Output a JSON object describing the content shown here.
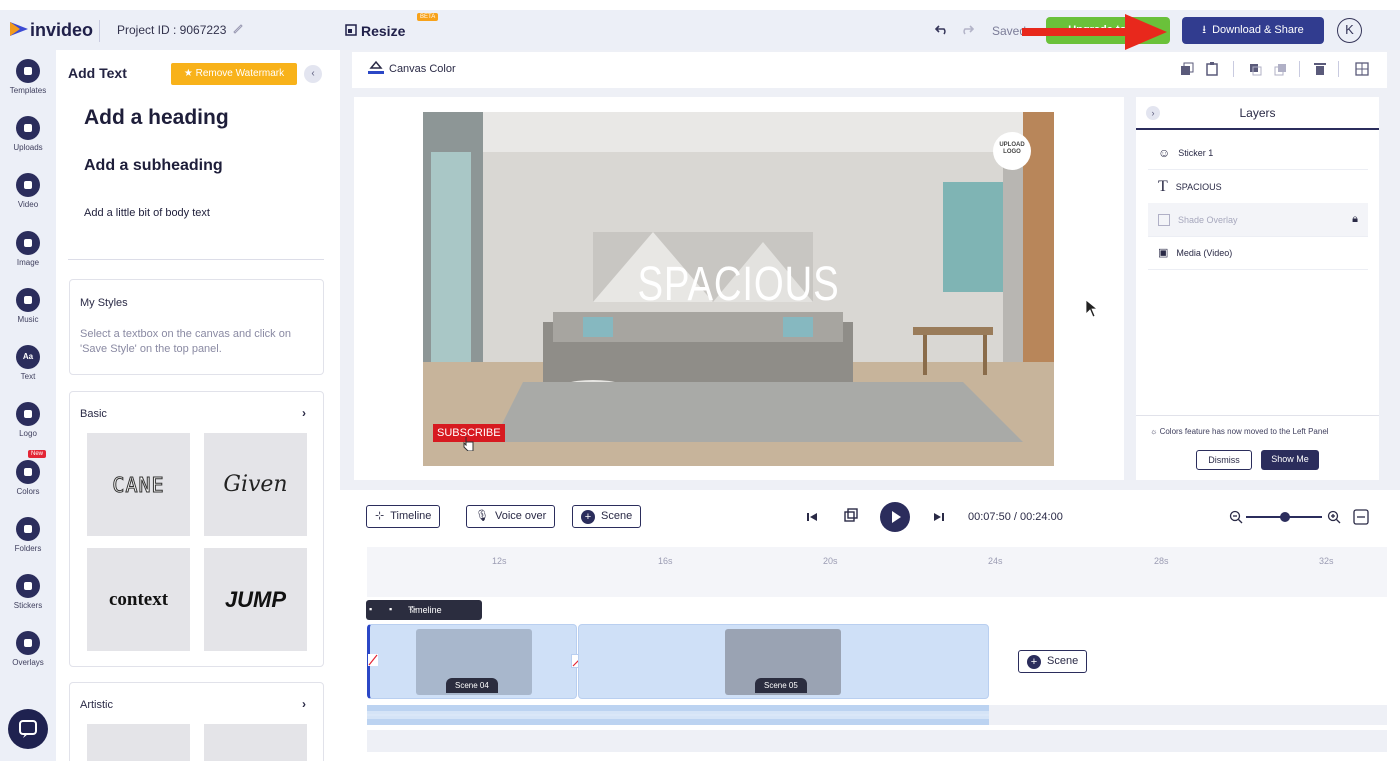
{
  "topbar": {
    "logo_text": "invideo",
    "project_id": "Project ID : 9067223",
    "resize_label": "Resize",
    "beta_badge": "BETA",
    "saved_text": "Saved",
    "green_button_label": "Upgrade to Pro",
    "download_label": "Download & Share",
    "avatar_initial": "K"
  },
  "rail": {
    "items": [
      {
        "label": "Templates",
        "icon": "templates-icon"
      },
      {
        "label": "Uploads",
        "icon": "upload-icon"
      },
      {
        "label": "Video",
        "icon": "video-icon"
      },
      {
        "label": "Image",
        "icon": "image-icon"
      },
      {
        "label": "Music",
        "icon": "music-icon"
      },
      {
        "label": "Text",
        "icon": "text-icon",
        "badge": "Aa"
      },
      {
        "label": "Logo",
        "icon": "logo-icon"
      },
      {
        "label": "Colors",
        "icon": "colors-icon",
        "new_badge": "New"
      },
      {
        "label": "Folders",
        "icon": "folder-icon"
      },
      {
        "label": "Stickers",
        "icon": "sticker-icon"
      },
      {
        "label": "Overlays",
        "icon": "overlays-icon"
      }
    ]
  },
  "left_panel": {
    "title": "Add Text",
    "remove_watermark": "Remove Watermark",
    "heading": "Add a heading",
    "subheading": "Add a subheading",
    "body_text": "Add a little bit of body text",
    "my_styles": {
      "title": "My Styles",
      "description": "Select a textbox on the canvas and click on 'Save Style' on the top panel."
    },
    "basic": {
      "title": "Basic",
      "tiles": [
        "CANE",
        "Given",
        "context",
        "JUMP"
      ]
    },
    "artistic": {
      "title": "Artistic"
    }
  },
  "canvas": {
    "canvas_color_label": "Canvas Color",
    "main_text": "SPACIOUS",
    "subscribe": "SUBSCRIBE",
    "upload_logo": "UPLOAD LOGO"
  },
  "layers": {
    "title": "Layers",
    "items": [
      {
        "label": "Sticker 1",
        "icon": "sticker-icon"
      },
      {
        "label": "SPACIOUS",
        "icon": "text-t-icon"
      },
      {
        "label": "Shade Overlay",
        "icon": "overlay-icon",
        "locked": true
      },
      {
        "label": "Media (Video)",
        "icon": "media-icon"
      }
    ],
    "colors_note": "Colors feature has now moved to the Left Panel",
    "dismiss": "Dismiss",
    "show_me": "Show Me"
  },
  "timeline": {
    "timeline_label": "Timeline",
    "voice_over_label": "Voice over",
    "scene_label": "Scene",
    "time_display": "00:07:50 / 00:24:00",
    "ruler_ticks": [
      "12s",
      "16s",
      "20s",
      "24s",
      "28s",
      "32s"
    ],
    "tag_timeline": "Timeline",
    "scenes": [
      "Scene 04",
      "Scene 05"
    ],
    "add_scene_label": "Scene"
  },
  "colors": {
    "accent": "#2b2d5c",
    "watermark": "#f8b21a",
    "subscribe_red": "#d71a20",
    "green": "#6ac13a",
    "arrow_red": "#e8281c"
  }
}
